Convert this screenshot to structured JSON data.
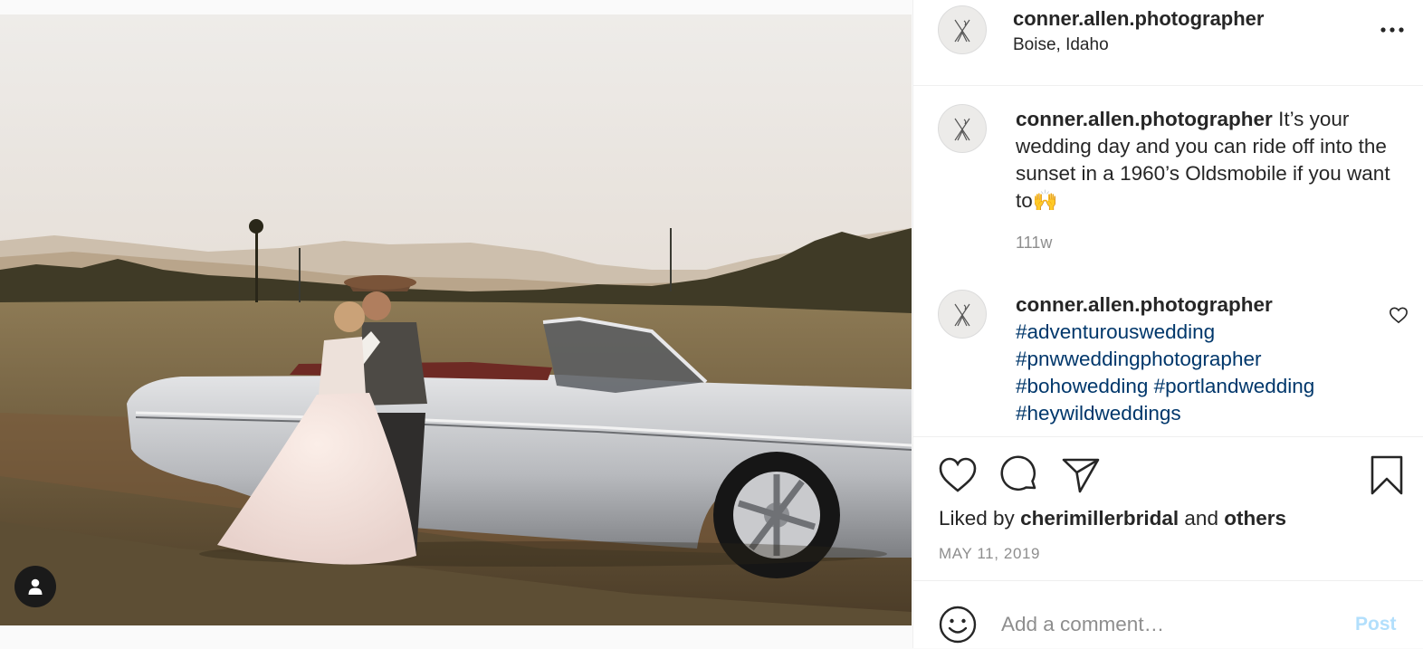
{
  "post": {
    "username": "conner.allen.photographer",
    "location": "Boise, Idaho",
    "caption": {
      "username": "conner.allen.photographer",
      "text": "It’s your wedding day and you can ride off into the sunset in a 1960’s Oldsmobile if you want to🙌",
      "age": "111w"
    },
    "comments": [
      {
        "username": "conner.allen.photographer",
        "hashtags": [
          "#adventurouswedding",
          "#pnwweddingphotographer",
          "#bohowedding #portlandwedding",
          "#heywildweddings"
        ]
      }
    ],
    "likes": {
      "prefix": "Liked by",
      "user": "cherimillerbridal",
      "and": "and",
      "others": "others"
    },
    "date": "MAY 11, 2019",
    "comment_box": {
      "placeholder": "Add a comment…",
      "post_label": "Post"
    }
  },
  "icons": {
    "more": "more-horizontal-icon",
    "like": "heart-icon",
    "comment": "comment-bubble-icon",
    "share": "paper-plane-icon",
    "save": "bookmark-icon",
    "emoji": "smiley-icon",
    "tag_user": "person-icon"
  },
  "colors": {
    "text": "#262626",
    "secondary": "#8e8e8e",
    "hashtag": "#00376b",
    "post_disabled": "#b2dffc"
  }
}
